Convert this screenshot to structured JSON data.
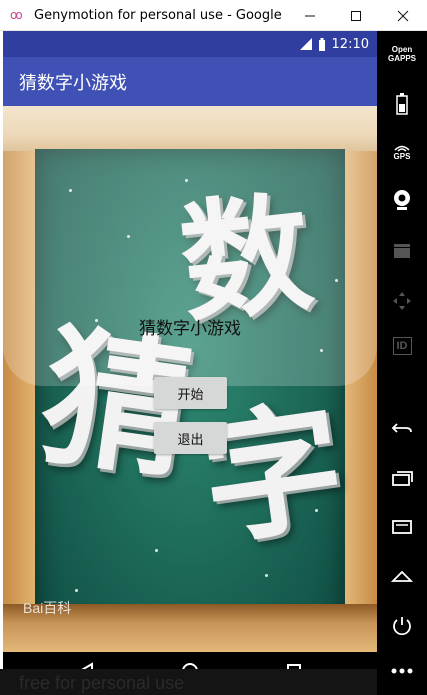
{
  "window": {
    "title": "Genymotion for personal use - Google N...",
    "icon": "oo",
    "minimize_icon": "minimize-icon",
    "maximize_icon": "maximize-icon",
    "close_icon": "close-icon"
  },
  "statusbar": {
    "time": "12:10"
  },
  "appbar": {
    "title": "猜数字小游戏"
  },
  "content": {
    "game_title": "猜数字小游戏",
    "start_button": "开始",
    "exit_button": "退出",
    "watermark": "Bai百科"
  },
  "sidepanel": {
    "open_gapps": "Open\nGAPPS",
    "gps": "GPS",
    "id_label": "ID"
  },
  "footer": {
    "free_text": "free for personal use"
  },
  "colors": {
    "statusbar": "#303f9f",
    "appbar": "#3f51b5",
    "button": "#d6d7d7"
  }
}
